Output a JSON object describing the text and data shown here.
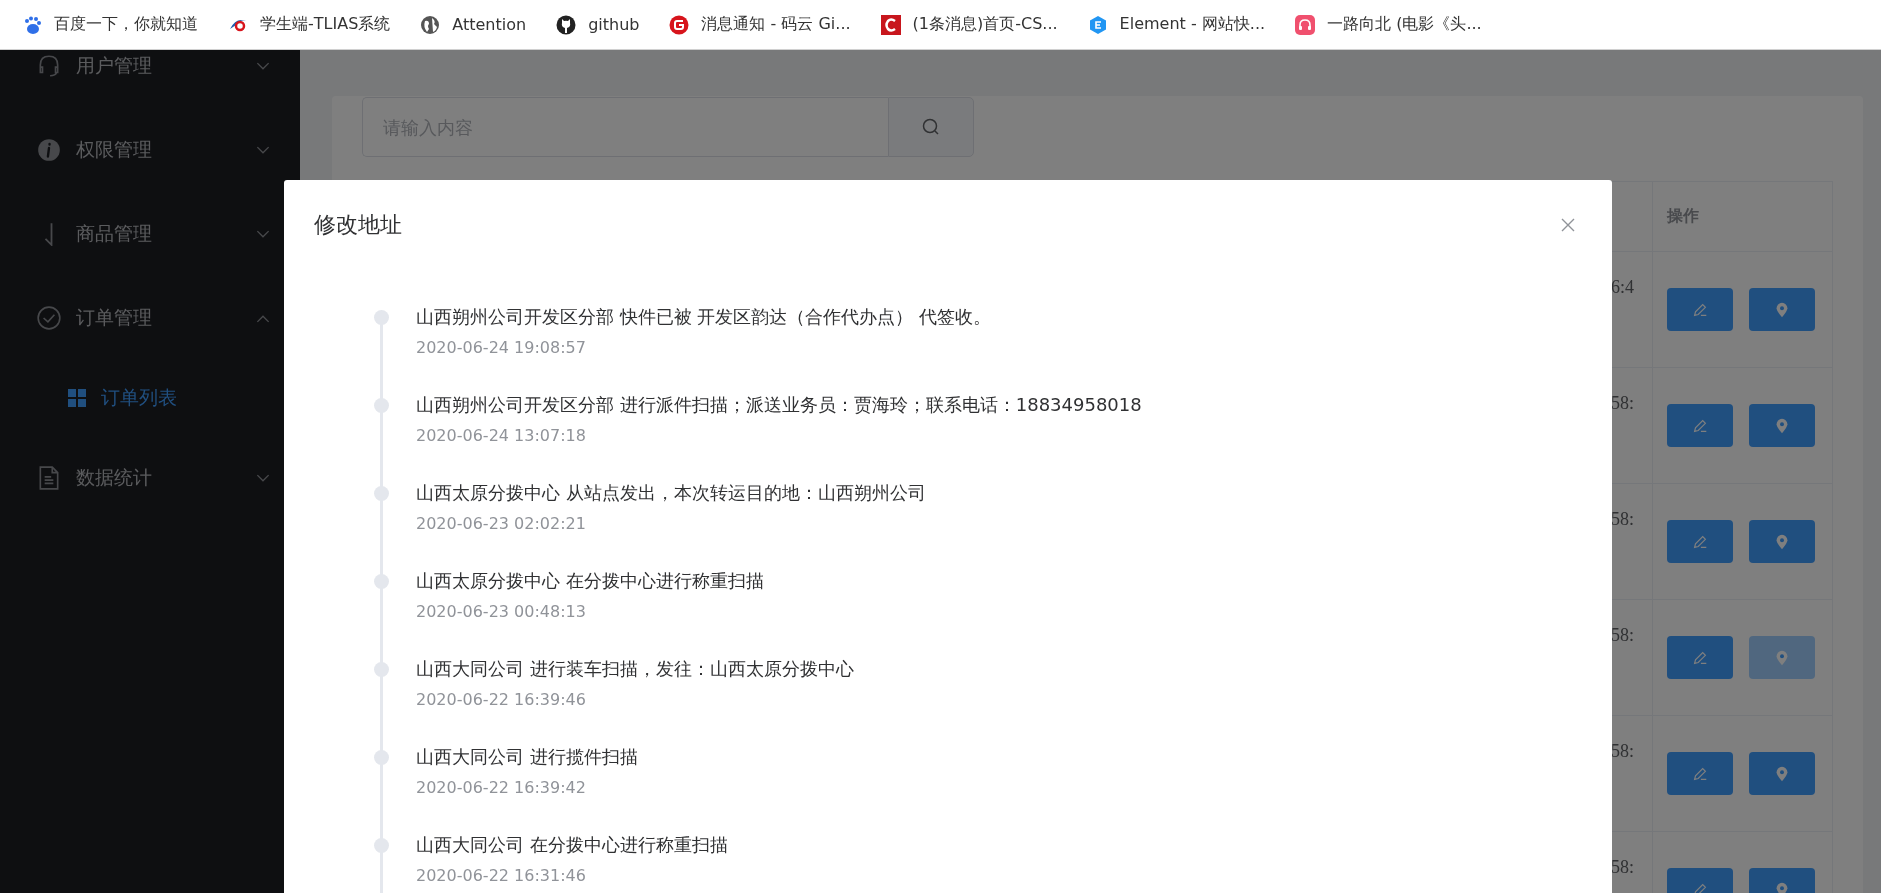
{
  "bookmarks": [
    {
      "label": "百度一下，你就知道"
    },
    {
      "label": "学生端-TLIAS系统"
    },
    {
      "label": "Attention"
    },
    {
      "label": "github"
    },
    {
      "label": "消息通知 - 码云 Gi..."
    },
    {
      "label": "(1条消息)首页-CS..."
    },
    {
      "label": "Element - 网站快..."
    },
    {
      "label": "一路向北 (电影《头..."
    }
  ],
  "sidebar": {
    "items": [
      {
        "label": "用户管理",
        "expanded": false
      },
      {
        "label": "权限管理",
        "expanded": false
      },
      {
        "label": "商品管理",
        "expanded": false
      },
      {
        "label": "订单管理",
        "expanded": true,
        "children": [
          {
            "label": "订单列表",
            "selected": true
          }
        ]
      },
      {
        "label": "数据统计",
        "expanded": false
      }
    ]
  },
  "search": {
    "placeholder": "请输入内容"
  },
  "table": {
    "columns": [
      "",
      "操作"
    ],
    "rows": [
      {
        "column_1": "6:4",
        "location_highlighted": false
      },
      {
        "column_1": "58:",
        "location_highlighted": false
      },
      {
        "column_1": "58:",
        "location_highlighted": false
      },
      {
        "column_1": "58:",
        "location_highlighted": true
      },
      {
        "column_1": "58:",
        "location_highlighted": false
      },
      {
        "column_1": "58:",
        "location_highlighted": false
      }
    ]
  },
  "dialog": {
    "title": "修改地址",
    "timeline": [
      {
        "content": "山西朔州公司开发区分部 快件已被 开发区韵达（合作代办点） 代签收。",
        "timestamp": "2020-06-24 19:08:57"
      },
      {
        "content": "山西朔州公司开发区分部 进行派件扫描；派送业务员：贾海玲；联系电话：18834958018",
        "timestamp": "2020-06-24 13:07:18"
      },
      {
        "content": "山西太原分拨中心 从站点发出，本次转运目的地：山西朔州公司",
        "timestamp": "2020-06-23 02:02:21"
      },
      {
        "content": "山西太原分拨中心 在分拨中心进行称重扫描",
        "timestamp": "2020-06-23 00:48:13"
      },
      {
        "content": "山西大同公司 进行装车扫描，发往：山西太原分拨中心",
        "timestamp": "2020-06-22 16:39:46"
      },
      {
        "content": "山西大同公司 进行揽件扫描",
        "timestamp": "2020-06-22 16:39:42"
      },
      {
        "content": "山西大同公司 在分拨中心进行称重扫描",
        "timestamp": "2020-06-22 16:31:46"
      }
    ]
  }
}
